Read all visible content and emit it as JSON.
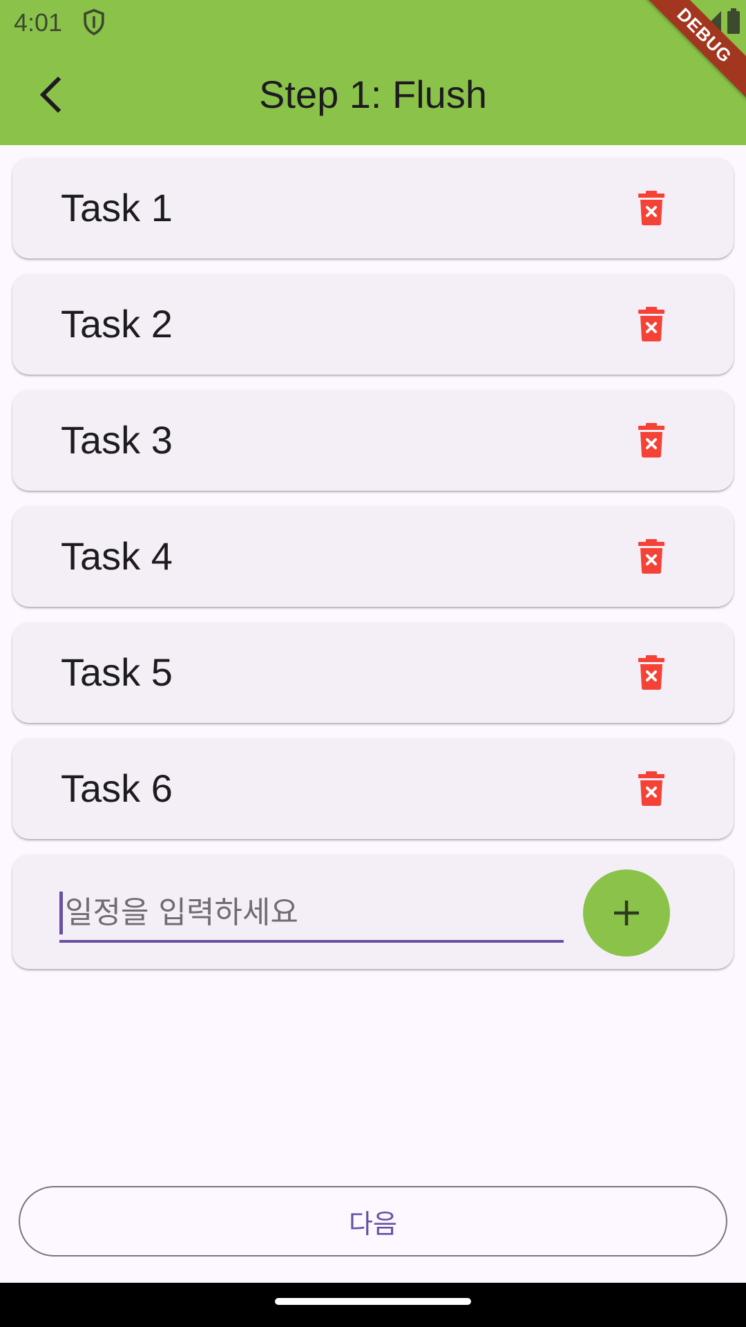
{
  "status_bar": {
    "time": "4:01"
  },
  "debug_banner": "DEBUG",
  "app_bar": {
    "title": "Step 1: Flush"
  },
  "tasks": [
    {
      "label": "Task 1"
    },
    {
      "label": "Task 2"
    },
    {
      "label": "Task 3"
    },
    {
      "label": "Task 4"
    },
    {
      "label": "Task 5"
    },
    {
      "label": "Task 6"
    }
  ],
  "new_task": {
    "value": "",
    "placeholder": "일정을 입력하세요"
  },
  "next_button": {
    "label": "다음"
  },
  "colors": {
    "app_bar": "#8BC34A",
    "delete_icon": "#F44336",
    "accent": "#6750A4",
    "card": "#F4EFF6",
    "background": "#FDF7FF"
  },
  "icons": {
    "back": "arrow-back-icon",
    "delete": "trash-x-icon",
    "add": "plus-icon"
  }
}
